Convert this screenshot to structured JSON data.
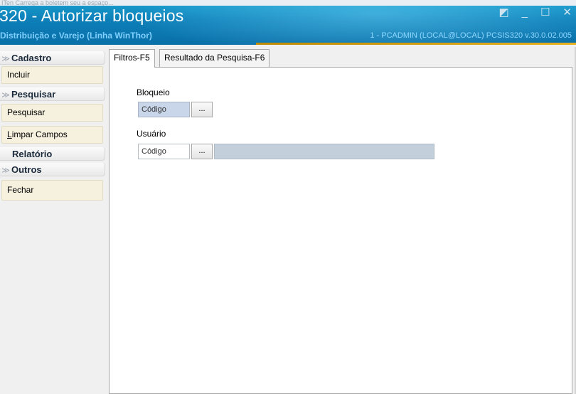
{
  "window": {
    "top_clipped": "ITen Carrega a boletem seu a espaço...",
    "title": "320 - Autorizar bloqueios",
    "subtitle": "Distribuição e Varejo (Linha WinThor)",
    "user_info": "1 - PCADMIN (LOCAL@LOCAL)   PCSIS320  v.30.0.02.005",
    "controls": {
      "restore_glyph": "◩",
      "minimize_glyph": "_",
      "maximize_glyph": "☐",
      "close_glyph": "✕"
    }
  },
  "sidebar": {
    "groups": [
      {
        "title": "Cadastro",
        "chevron": "≫",
        "items": [
          {
            "label": "Incluir"
          }
        ]
      },
      {
        "title": "Pesquisar",
        "chevron": "≫",
        "items": [
          {
            "label": "Pesquisar"
          },
          {
            "label": "Limpar Campos"
          }
        ]
      },
      {
        "title": "Relatório",
        "chevron": "",
        "items": []
      },
      {
        "title": "Outros",
        "chevron": "≫",
        "items": [
          {
            "label": "Fechar"
          }
        ]
      }
    ]
  },
  "tabs": [
    {
      "label": "Filtros-F5",
      "active": true
    },
    {
      "label": "Resultado da Pesquisa-F6",
      "active": false
    }
  ],
  "filters": {
    "bloqueio": {
      "label": "Bloqueio",
      "code_value": "Código",
      "button_label": "..."
    },
    "usuario": {
      "label": "Usuário",
      "code_value": "Código",
      "button_label": "...",
      "description_value": ""
    }
  },
  "colors": {
    "titlebar": "#0d7fb8",
    "sidebar_item_bg": "#f6f1de",
    "filled_field_bg": "#c9d6ea",
    "description_bg": "#c3cfdb"
  }
}
